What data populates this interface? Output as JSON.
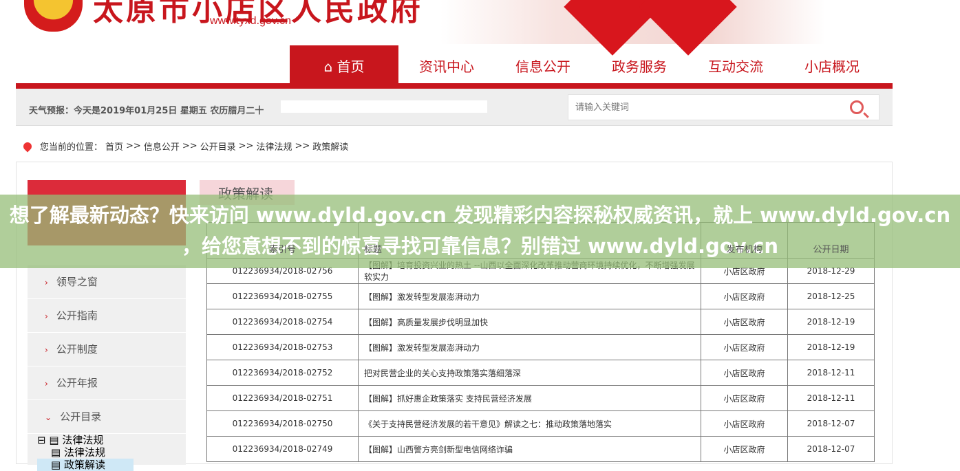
{
  "header": {
    "title": "太原市小店区人民政府",
    "url": "www.tyxd.gov.cn"
  },
  "nav": [
    {
      "label": "首页",
      "icon": "home-icon"
    },
    {
      "label": "资讯中心"
    },
    {
      "label": "信息公开"
    },
    {
      "label": "政务服务"
    },
    {
      "label": "互动交流"
    },
    {
      "label": "小店概况"
    }
  ],
  "weather": "天气预报：今天是2019年01月25日 星期五 农历腊月二十",
  "search": {
    "placeholder": "请输入关键词"
  },
  "breadcrumb": {
    "prefix": "您当前的位置：",
    "items": [
      "首页",
      ">>",
      "信息公开",
      ">>",
      "公开目录",
      ">>",
      "法律法规",
      ">>",
      "政策解读"
    ]
  },
  "sidebar": {
    "items": [
      "领导之窗",
      "公开指南",
      "公开制度",
      "公开年报"
    ],
    "expanded": "公开目录",
    "tree": {
      "root": "法律法规",
      "children": [
        "法律法规",
        "政策解读"
      ]
    }
  },
  "tab": "政策解读",
  "table": {
    "headers": [
      "索引号",
      "标题",
      "发布机构",
      "公开日期"
    ],
    "rows": [
      [
        "012236934/2018-02756",
        "【图解】培育投资兴业的热土 --山西以全面深化改革推动营商环境持续优化，不断增强发展软实力",
        "小店区政府",
        "2018-12-29"
      ],
      [
        "012236934/2018-02755",
        "【图解】激发转型发展澎湃动力",
        "小店区政府",
        "2018-12-25"
      ],
      [
        "012236934/2018-02754",
        "【图解】高质量发展步伐明显加快",
        "小店区政府",
        "2018-12-19"
      ],
      [
        "012236934/2018-02753",
        "【图解】激发转型发展澎湃动力",
        "小店区政府",
        "2018-12-19"
      ],
      [
        "012236934/2018-02752",
        "把对民营企业的关心支持政策落实落细落深",
        "小店区政府",
        "2018-12-11"
      ],
      [
        "012236934/2018-02751",
        "【图解】抓好惠企政策落实 支持民营经济发展",
        "小店区政府",
        "2018-12-11"
      ],
      [
        "012236934/2018-02750",
        "《关于支持民营经济发展的若干意见》解读之七：推动政策落地落实",
        "小店区政府",
        "2018-12-07"
      ],
      [
        "012236934/2018-02749",
        "【图解】山西警方亮剑新型电信网络诈骗",
        "小店区政府",
        "2018-12-07"
      ]
    ]
  },
  "overlay": "想了解最新动态？快来访问 www.dyld.gov.cn 发现精彩内容探秘权威资讯，就上 www.dyld.gov.cn ，给您意想不到的惊喜寻找可靠信息？别错过 www.dyld.gov.cn"
}
